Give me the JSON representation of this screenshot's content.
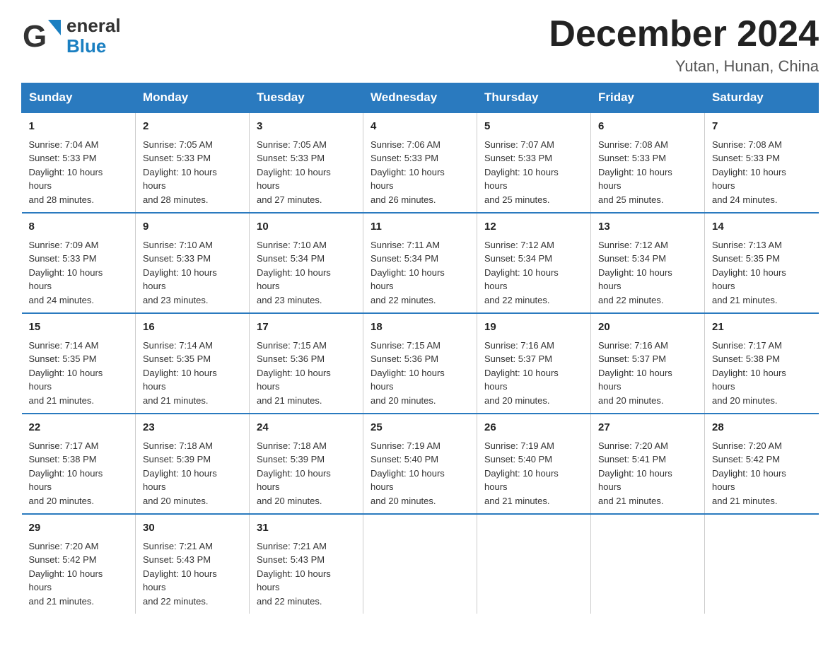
{
  "logo": {
    "general": "General",
    "blue": "Blue",
    "arrow_color": "#1a6bb5"
  },
  "title": {
    "month_year": "December 2024",
    "location": "Yutan, Hunan, China"
  },
  "header_days": [
    "Sunday",
    "Monday",
    "Tuesday",
    "Wednesday",
    "Thursday",
    "Friday",
    "Saturday"
  ],
  "weeks": [
    [
      {
        "day": "1",
        "sunrise": "7:04 AM",
        "sunset": "5:33 PM",
        "daylight": "10 hours and 28 minutes."
      },
      {
        "day": "2",
        "sunrise": "7:05 AM",
        "sunset": "5:33 PM",
        "daylight": "10 hours and 28 minutes."
      },
      {
        "day": "3",
        "sunrise": "7:05 AM",
        "sunset": "5:33 PM",
        "daylight": "10 hours and 27 minutes."
      },
      {
        "day": "4",
        "sunrise": "7:06 AM",
        "sunset": "5:33 PM",
        "daylight": "10 hours and 26 minutes."
      },
      {
        "day": "5",
        "sunrise": "7:07 AM",
        "sunset": "5:33 PM",
        "daylight": "10 hours and 25 minutes."
      },
      {
        "day": "6",
        "sunrise": "7:08 AM",
        "sunset": "5:33 PM",
        "daylight": "10 hours and 25 minutes."
      },
      {
        "day": "7",
        "sunrise": "7:08 AM",
        "sunset": "5:33 PM",
        "daylight": "10 hours and 24 minutes."
      }
    ],
    [
      {
        "day": "8",
        "sunrise": "7:09 AM",
        "sunset": "5:33 PM",
        "daylight": "10 hours and 24 minutes."
      },
      {
        "day": "9",
        "sunrise": "7:10 AM",
        "sunset": "5:33 PM",
        "daylight": "10 hours and 23 minutes."
      },
      {
        "day": "10",
        "sunrise": "7:10 AM",
        "sunset": "5:34 PM",
        "daylight": "10 hours and 23 minutes."
      },
      {
        "day": "11",
        "sunrise": "7:11 AM",
        "sunset": "5:34 PM",
        "daylight": "10 hours and 22 minutes."
      },
      {
        "day": "12",
        "sunrise": "7:12 AM",
        "sunset": "5:34 PM",
        "daylight": "10 hours and 22 minutes."
      },
      {
        "day": "13",
        "sunrise": "7:12 AM",
        "sunset": "5:34 PM",
        "daylight": "10 hours and 22 minutes."
      },
      {
        "day": "14",
        "sunrise": "7:13 AM",
        "sunset": "5:35 PM",
        "daylight": "10 hours and 21 minutes."
      }
    ],
    [
      {
        "day": "15",
        "sunrise": "7:14 AM",
        "sunset": "5:35 PM",
        "daylight": "10 hours and 21 minutes."
      },
      {
        "day": "16",
        "sunrise": "7:14 AM",
        "sunset": "5:35 PM",
        "daylight": "10 hours and 21 minutes."
      },
      {
        "day": "17",
        "sunrise": "7:15 AM",
        "sunset": "5:36 PM",
        "daylight": "10 hours and 21 minutes."
      },
      {
        "day": "18",
        "sunrise": "7:15 AM",
        "sunset": "5:36 PM",
        "daylight": "10 hours and 20 minutes."
      },
      {
        "day": "19",
        "sunrise": "7:16 AM",
        "sunset": "5:37 PM",
        "daylight": "10 hours and 20 minutes."
      },
      {
        "day": "20",
        "sunrise": "7:16 AM",
        "sunset": "5:37 PM",
        "daylight": "10 hours and 20 minutes."
      },
      {
        "day": "21",
        "sunrise": "7:17 AM",
        "sunset": "5:38 PM",
        "daylight": "10 hours and 20 minutes."
      }
    ],
    [
      {
        "day": "22",
        "sunrise": "7:17 AM",
        "sunset": "5:38 PM",
        "daylight": "10 hours and 20 minutes."
      },
      {
        "day": "23",
        "sunrise": "7:18 AM",
        "sunset": "5:39 PM",
        "daylight": "10 hours and 20 minutes."
      },
      {
        "day": "24",
        "sunrise": "7:18 AM",
        "sunset": "5:39 PM",
        "daylight": "10 hours and 20 minutes."
      },
      {
        "day": "25",
        "sunrise": "7:19 AM",
        "sunset": "5:40 PM",
        "daylight": "10 hours and 20 minutes."
      },
      {
        "day": "26",
        "sunrise": "7:19 AM",
        "sunset": "5:40 PM",
        "daylight": "10 hours and 21 minutes."
      },
      {
        "day": "27",
        "sunrise": "7:20 AM",
        "sunset": "5:41 PM",
        "daylight": "10 hours and 21 minutes."
      },
      {
        "day": "28",
        "sunrise": "7:20 AM",
        "sunset": "5:42 PM",
        "daylight": "10 hours and 21 minutes."
      }
    ],
    [
      {
        "day": "29",
        "sunrise": "7:20 AM",
        "sunset": "5:42 PM",
        "daylight": "10 hours and 21 minutes."
      },
      {
        "day": "30",
        "sunrise": "7:21 AM",
        "sunset": "5:43 PM",
        "daylight": "10 hours and 22 minutes."
      },
      {
        "day": "31",
        "sunrise": "7:21 AM",
        "sunset": "5:43 PM",
        "daylight": "10 hours and 22 minutes."
      },
      {
        "day": "",
        "sunrise": "",
        "sunset": "",
        "daylight": ""
      },
      {
        "day": "",
        "sunrise": "",
        "sunset": "",
        "daylight": ""
      },
      {
        "day": "",
        "sunrise": "",
        "sunset": "",
        "daylight": ""
      },
      {
        "day": "",
        "sunrise": "",
        "sunset": "",
        "daylight": ""
      }
    ]
  ],
  "labels": {
    "sunrise": "Sunrise: ",
    "sunset": "Sunset: ",
    "daylight": "Daylight: "
  }
}
